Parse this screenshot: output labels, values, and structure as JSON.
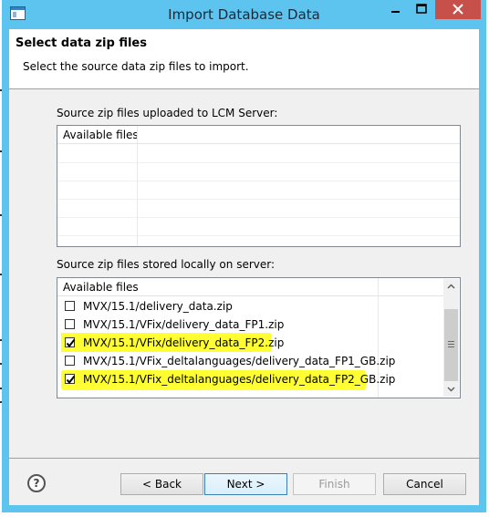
{
  "window": {
    "title": "Import Database Data"
  },
  "header": {
    "title": "Select data zip files",
    "subtitle": "Select the source data zip files to import."
  },
  "uploaded_section": {
    "label": "Source zip files uploaded to LCM Server:",
    "column_header": "Available files"
  },
  "local_section": {
    "label": "Source zip files stored locally on server:",
    "column_header": "Available files",
    "files": [
      {
        "name": "MVX/15.1/delivery_data.zip",
        "checked": false
      },
      {
        "name": "MVX/15.1/VFix/delivery_data_FP1.zip",
        "checked": false
      },
      {
        "name": "MVX/15.1/VFix/delivery_data_FP2.zip",
        "checked": true
      },
      {
        "name": "MVX/15.1/VFix_deltalanguages/delivery_data_FP1_GB.zip",
        "checked": false
      },
      {
        "name": "MVX/15.1/VFix_deltalanguages/delivery_data_FP2_GB.zip",
        "checked": true
      }
    ]
  },
  "buttons": {
    "back": "< Back",
    "next": "Next >",
    "finish": "Finish",
    "cancel": "Cancel"
  },
  "colors": {
    "window_frame": "#5cc4ef",
    "close_button": "#c7504a",
    "highlight": "#ffff33"
  }
}
